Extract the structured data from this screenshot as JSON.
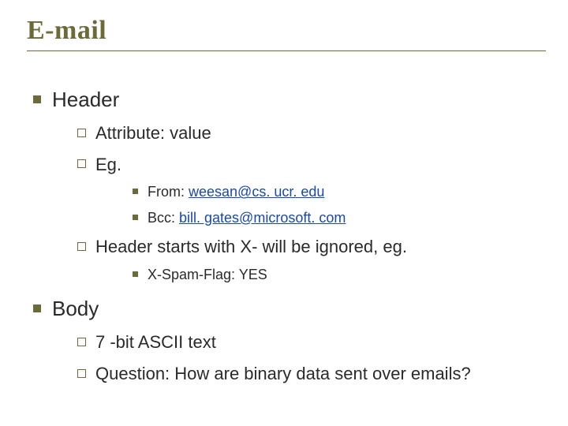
{
  "title": "E-mail",
  "sections": [
    {
      "label": "Header",
      "subs": [
        {
          "label": "Attribute: value"
        },
        {
          "label": "Eg.",
          "items": [
            {
              "prefix": "From: ",
              "link": "weesan@cs. ucr. edu"
            },
            {
              "prefix": "Bcc: ",
              "link": "bill. gates@microsoft. com"
            }
          ]
        },
        {
          "label": "Header starts with X- will be ignored, eg.",
          "items": [
            {
              "prefix": "X-Spam-Flag: YES"
            }
          ]
        }
      ]
    },
    {
      "label": "Body",
      "subs": [
        {
          "label": "7 -bit ASCII text"
        },
        {
          "label": "Question: How are binary data sent over emails?"
        }
      ]
    }
  ]
}
